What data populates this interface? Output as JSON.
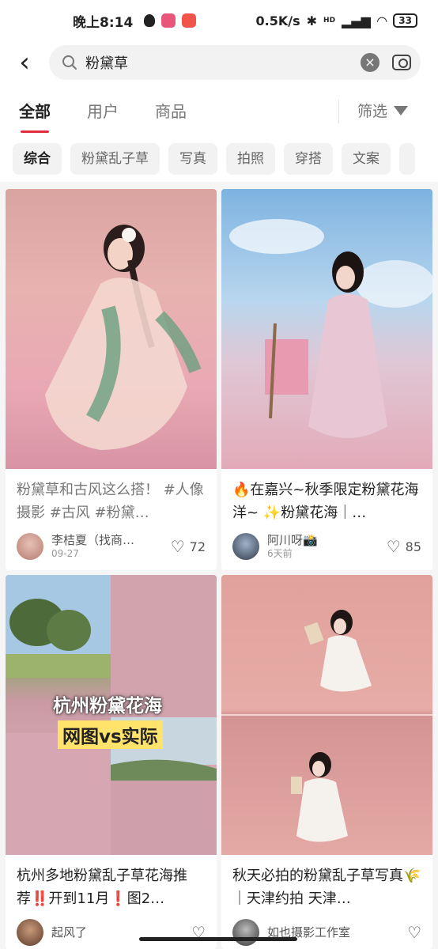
{
  "status_bar": {
    "time": "晚上8:14",
    "network_speed": "0.5K/s",
    "battery": "33",
    "signal_labels": "HD"
  },
  "search": {
    "query": "粉黛草",
    "back_icon": "chevron-left-icon",
    "search_icon": "search-icon",
    "clear_icon": "close-circle-icon",
    "camera_icon": "camera-icon"
  },
  "tabs": {
    "items": [
      "全部",
      "用户",
      "商品"
    ],
    "active": "全部",
    "filter_label": "筛选"
  },
  "chips": [
    "综合",
    "粉黛乱子草",
    "写真",
    "拍照",
    "穿搭",
    "文案"
  ],
  "colors": {
    "accent": "#e02e3e",
    "chip_bg": "#f2f2f2",
    "page_bg": "#f5f5f5"
  },
  "feed": [
    {
      "title": "粉黛草和古风这么搭！ #人像摄影 #古风 #粉黛…",
      "author": "李桔夏（找商…",
      "date": "09-27",
      "likes": "72"
    },
    {
      "title": "🔥在嘉兴~秋季限定粉黛花海洋~ ✨粉黛花海｜…",
      "author": "阿川呀📸",
      "date": "6天前",
      "likes": "85"
    },
    {
      "title": "杭州多地粉黛乱子草花海推荐‼️开到11月❗图2…",
      "author": "起风了",
      "date": "",
      "likes": "",
      "overlay_line1": "杭州粉黛花海",
      "overlay_line2": "网图vs实际"
    },
    {
      "title": "秋天必拍的粉黛乱子草写真🌾｜天津约拍 天津…",
      "author": "如也摄影工作室",
      "date": "",
      "likes": ""
    }
  ]
}
